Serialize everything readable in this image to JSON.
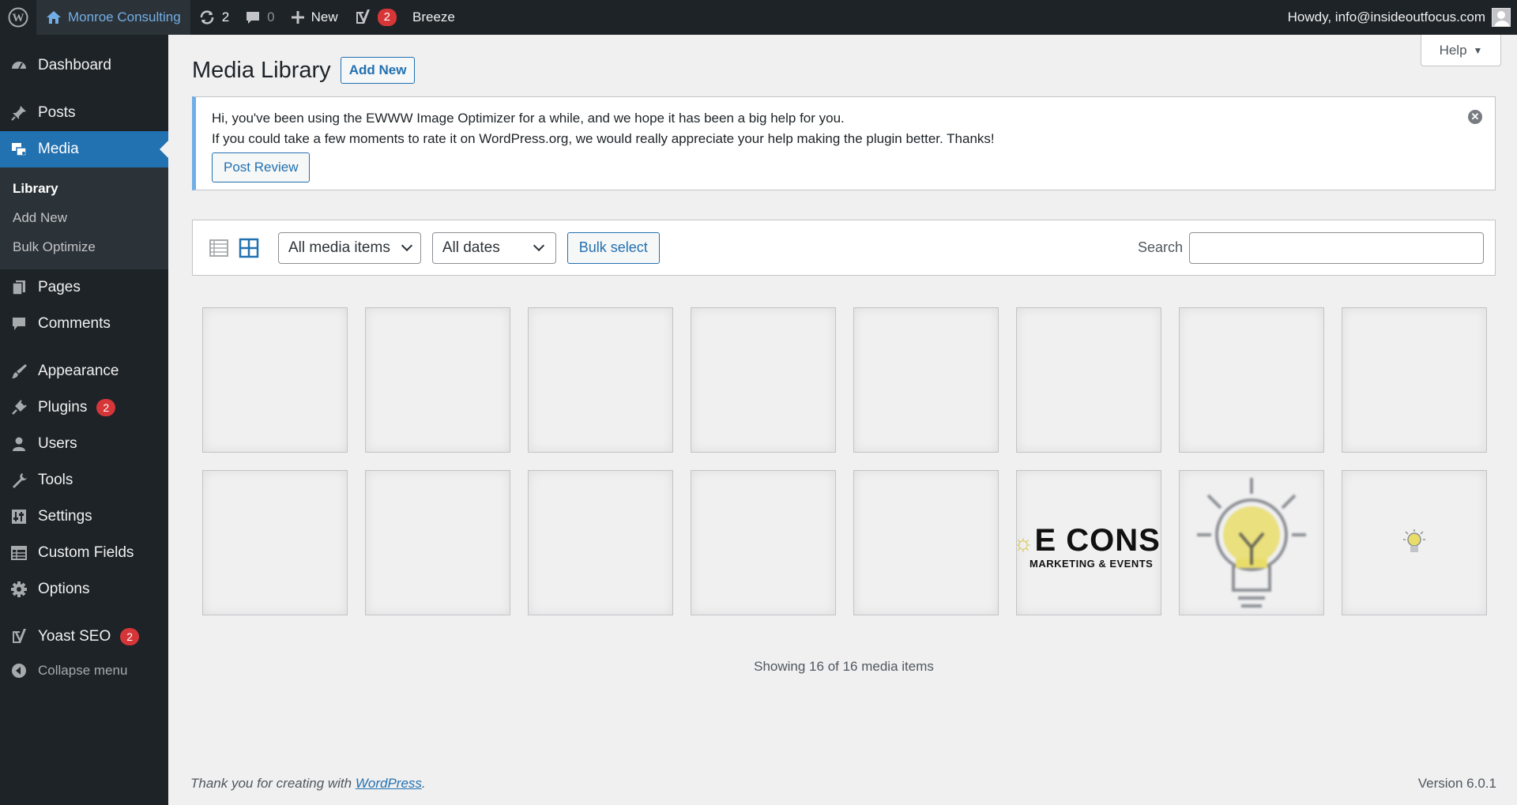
{
  "adminbar": {
    "site_name": "Monroe Consulting",
    "updates_count": "2",
    "comments_count": "0",
    "new_label": "New",
    "yoast_badge": "2",
    "breeze_label": "Breeze",
    "greeting": "Howdy, info@insideoutfocus.com"
  },
  "sidebar": {
    "dashboard": "Dashboard",
    "posts": "Posts",
    "media": "Media",
    "submenu": {
      "library": "Library",
      "add_new": "Add New",
      "bulk_optimize": "Bulk Optimize"
    },
    "pages": "Pages",
    "comments": "Comments",
    "appearance": "Appearance",
    "plugins": "Plugins",
    "plugins_badge": "2",
    "users": "Users",
    "tools": "Tools",
    "settings": "Settings",
    "custom_fields": "Custom Fields",
    "options": "Options",
    "yoast": "Yoast SEO",
    "yoast_badge": "2",
    "collapse": "Collapse menu"
  },
  "header": {
    "help": "Help",
    "title": "Media Library",
    "add_new": "Add New"
  },
  "notice": {
    "line1": "Hi, you've been using the EWWW Image Optimizer for a while, and we hope it has been a big help for you.",
    "line2": "If you could take a few moments to rate it on WordPress.org, we would really appreciate your help making the plugin better. Thanks!",
    "button": "Post Review"
  },
  "toolbar": {
    "media_filter": "All media items",
    "date_filter": "All dates",
    "bulk_select": "Bulk select",
    "search_label": "Search",
    "search_value": ""
  },
  "grid": {
    "logo_text_main": "E CONSU",
    "logo_text_sub": "MARKETING & EVENTS"
  },
  "status": {
    "count_text": "Showing 16 of 16 media items"
  },
  "footer": {
    "thanks_prefix": "Thank you for creating with ",
    "thanks_link": "WordPress",
    "thanks_suffix": ".",
    "version": "Version 6.0.1"
  },
  "colors": {
    "admin_bg": "#1d2327",
    "accent": "#2271b1",
    "badge": "#d63638",
    "notice_border": "#72aee6"
  }
}
